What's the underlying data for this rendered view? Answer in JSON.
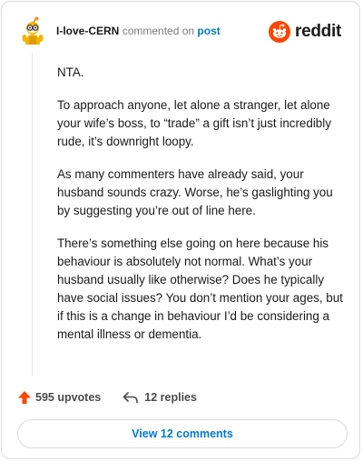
{
  "comment": {
    "username": "I-love-CERN",
    "action_text": "commented on",
    "post_link": "post",
    "paragraphs": [
      "NTA.",
      "To approach anyone, let alone a stranger, let alone your wife’s boss, to “trade” a gift isn’t just incredibly rude, it’s downright loopy.",
      "As many commenters have already said, your husband sounds crazy. Worse, he’s gaslighting you by suggesting you’re out of line here.",
      "There’s something else going on here because his behaviour is absolutely not normal. What’s your husband usually like otherwise? Does he typically have social issues? You don’t mention your ages, but if this is a change in behaviour I’d be considering a mental illness or dementia."
    ]
  },
  "brand": {
    "name": "reddit",
    "logo_icon": "reddit-snoo-icon",
    "accent": "#ff4500"
  },
  "actions": {
    "upvotes": "595 upvotes",
    "replies": "12 replies",
    "upvote_icon": "upvote-arrow-icon",
    "reply_icon": "reply-arrow-icon",
    "upvote_color": "#ff4500"
  },
  "view_button": {
    "label": "View 12 comments",
    "color": "#0079d3"
  }
}
